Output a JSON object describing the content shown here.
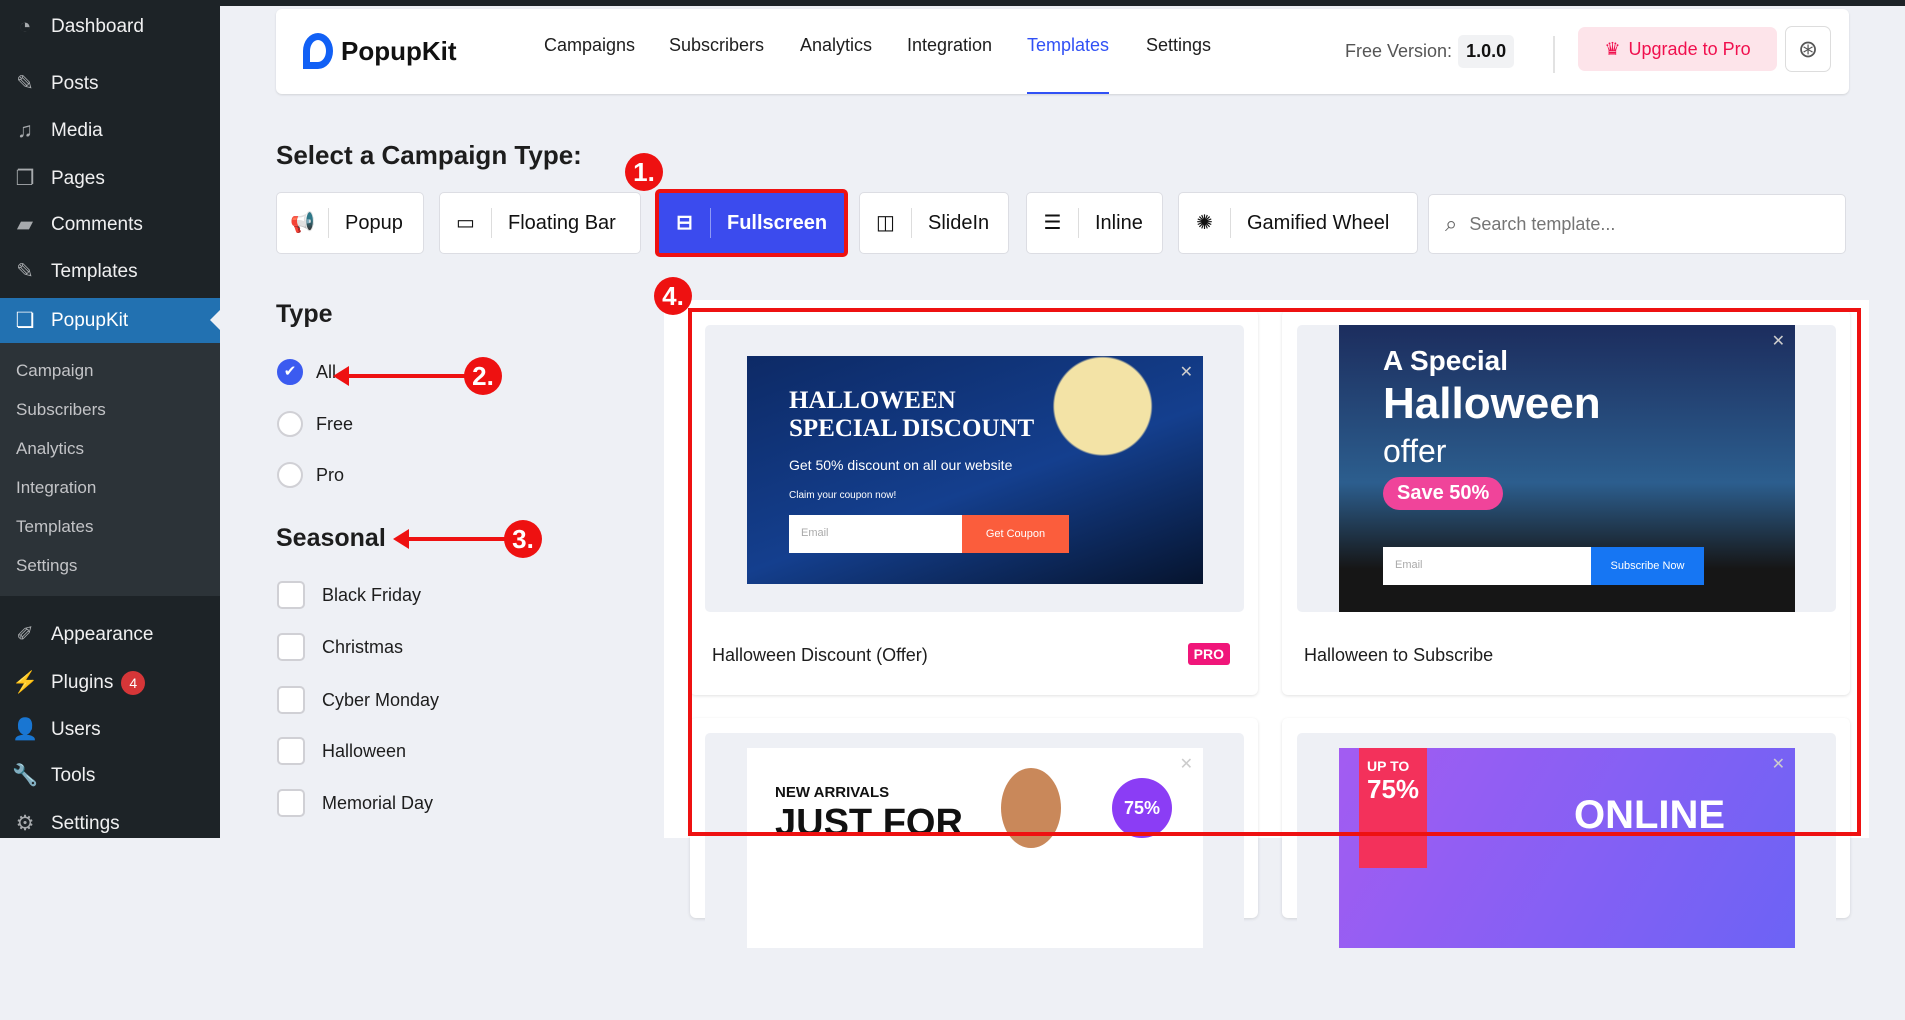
{
  "sidebar": {
    "top": [
      {
        "label": "Dashboard",
        "icon": "dashboard-icon"
      },
      {
        "label": "Posts",
        "icon": "pin-icon"
      },
      {
        "label": "Media",
        "icon": "media-icon"
      },
      {
        "label": "Pages",
        "icon": "pages-icon"
      },
      {
        "label": "Comments",
        "icon": "comment-icon"
      },
      {
        "label": "Templates",
        "icon": "pin-icon"
      },
      {
        "label": "PopupKit",
        "icon": "popupkit-icon"
      }
    ],
    "sub": [
      "Campaign",
      "Subscribers",
      "Analytics",
      "Integration",
      "Templates",
      "Settings"
    ],
    "bottom": [
      {
        "label": "Appearance"
      },
      {
        "label": "Plugins",
        "badge": "4"
      },
      {
        "label": "Users"
      },
      {
        "label": "Tools"
      },
      {
        "label": "Settings"
      }
    ]
  },
  "header": {
    "brand": "PopupKit",
    "nav": [
      "Campaigns",
      "Subscribers",
      "Analytics",
      "Integration",
      "Templates",
      "Settings"
    ],
    "active_nav": "Templates",
    "version_label": "Free Version:",
    "version": "1.0.0",
    "upgrade": "Upgrade to Pro"
  },
  "main": {
    "title": "Select a Campaign Type:",
    "types": [
      "Popup",
      "Floating Bar",
      "Fullscreen",
      "SlideIn",
      "Inline",
      "Gamified Wheel"
    ],
    "active_type": "Fullscreen",
    "search_placeholder": "Search template...",
    "filters": {
      "type_heading": "Type",
      "type_options": [
        "All",
        "Free",
        "Pro"
      ],
      "selected": "All",
      "seasonal_heading": "Seasonal",
      "seasonal": [
        "Black Friday",
        "Christmas",
        "Cyber Monday",
        "Halloween",
        "Memorial Day"
      ]
    },
    "templates": [
      {
        "title": "Halloween Discount (Offer)",
        "badge": "PRO",
        "t1": "HALLOWEEN",
        "t2": "SPECIAL DISCOUNT",
        "t3": "Get 50% discount on all our website",
        "t4": "Claim your coupon now!",
        "email": "Email",
        "btn": "Get Coupon"
      },
      {
        "title": "Halloween to Subscribe",
        "t1": "A Special",
        "t2": "Halloween",
        "t3": "offer",
        "save": "Save 50%",
        "email": "Email",
        "btn": "Subscribe Now"
      },
      {
        "t1": "NEW ARRIVALS",
        "t2": "JUST FOR",
        "pct": "75%"
      },
      {
        "t1": "UP TO",
        "t2": "75%",
        "t3": "ONLINE"
      }
    ]
  },
  "annotations": [
    "1.",
    "2.",
    "3.",
    "4."
  ],
  "colors": {
    "accent": "#3b4bee",
    "annotation": "#ee1111",
    "wp_sidebar": "#1d2327"
  }
}
